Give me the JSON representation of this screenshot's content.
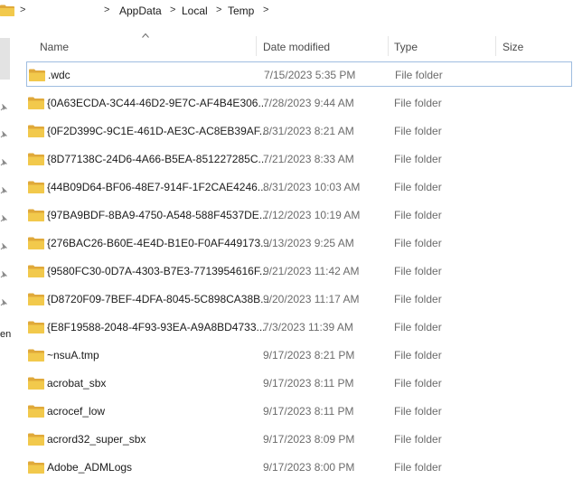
{
  "address": {
    "crumbs": [
      "AppData",
      "Local",
      "Temp"
    ],
    "separator": ">"
  },
  "nav": {
    "partial_label": "ent"
  },
  "header": {
    "name": "Name",
    "date": "Date modified",
    "type": "Type",
    "size": "Size"
  },
  "colors": {
    "folder": "#f2c94c",
    "folder_dark": "#e0a93a",
    "focus_outline": "#9fbde0"
  },
  "rows": [
    {
      "name": ".wdc",
      "date": "7/15/2023 5:35 PM",
      "type": "File folder"
    },
    {
      "name": "{0A63ECDA-3C44-46D2-9E7C-AF4B4E306...",
      "date": "7/28/2023 9:44 AM",
      "type": "File folder"
    },
    {
      "name": "{0F2D399C-9C1E-461D-AE3C-AC8EB39AF...",
      "date": "8/31/2023 8:21 AM",
      "type": "File folder"
    },
    {
      "name": "{8D77138C-24D6-4A66-B5EA-851227285C...",
      "date": "7/21/2023 8:33 AM",
      "type": "File folder"
    },
    {
      "name": "{44B09D64-BF06-48E7-914F-1F2CAE4246...",
      "date": "8/31/2023 10:03 AM",
      "type": "File folder"
    },
    {
      "name": "{97BA9BDF-8BA9-4750-A548-588F4537DE...",
      "date": "7/12/2023 10:19 AM",
      "type": "File folder"
    },
    {
      "name": "{276BAC26-B60E-4E4D-B1E0-F0AF449173...",
      "date": "9/13/2023 9:25 AM",
      "type": "File folder"
    },
    {
      "name": "{9580FC30-0D7A-4303-B7E3-7713954616F...",
      "date": "9/21/2023 11:42 AM",
      "type": "File folder"
    },
    {
      "name": "{D8720F09-7BEF-4DFA-8045-5C898CA38B...",
      "date": "9/20/2023 11:17 AM",
      "type": "File folder"
    },
    {
      "name": "{E8F19588-2048-4F93-93EA-A9A8BD4733...",
      "date": "7/3/2023 11:39 AM",
      "type": "File folder"
    },
    {
      "name": "~nsuA.tmp",
      "date": "9/17/2023 8:21 PM",
      "type": "File folder"
    },
    {
      "name": "acrobat_sbx",
      "date": "9/17/2023 8:11 PM",
      "type": "File folder"
    },
    {
      "name": "acrocef_low",
      "date": "9/17/2023 8:11 PM",
      "type": "File folder"
    },
    {
      "name": "acrord32_super_sbx",
      "date": "9/17/2023 8:09 PM",
      "type": "File folder"
    },
    {
      "name": "Adobe_ADMLogs",
      "date": "9/17/2023 8:00 PM",
      "type": "File folder"
    }
  ]
}
